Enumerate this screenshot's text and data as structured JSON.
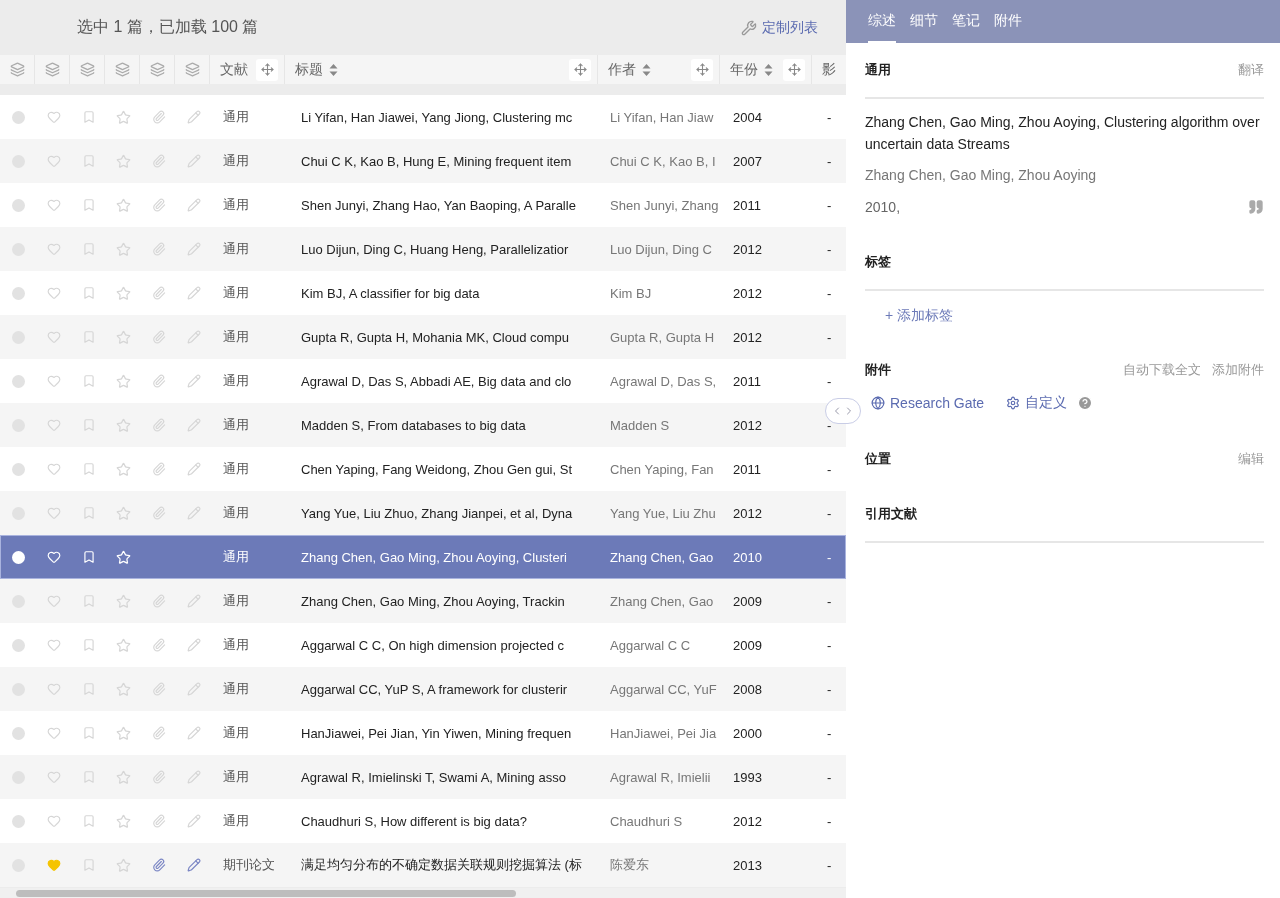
{
  "list_header": {
    "summary": "选中 1 篇，已加载 100 篇",
    "customize": "定制列表"
  },
  "columns": [
    {
      "kind": "icon"
    },
    {
      "kind": "icon"
    },
    {
      "kind": "icon"
    },
    {
      "kind": "icon"
    },
    {
      "kind": "icon"
    },
    {
      "kind": "icon"
    },
    {
      "kind": "text",
      "label": "文献",
      "sortable": false,
      "movable": true
    },
    {
      "kind": "text",
      "label": "标题",
      "sortable": true,
      "movable": true
    },
    {
      "kind": "text",
      "label": "作者",
      "sortable": true,
      "movable": true
    },
    {
      "kind": "text",
      "label": "年份",
      "sortable": true,
      "movable": true
    },
    {
      "kind": "text",
      "label": "影",
      "sortable": false,
      "movable": false
    }
  ],
  "rows": [
    {
      "type": "通用",
      "title": "Li Yifan, Han Jiawei, Yang Jiong, Clustering mc",
      "author": "Li Yifan, Han Jiaw",
      "year": "2004",
      "impact": "-",
      "selected": false,
      "favorite": false,
      "attachment": false,
      "note": false
    },
    {
      "type": "通用",
      "title": "Chui C K, Kao B, Hung E, Mining frequent item",
      "author": "Chui C K, Kao B, I",
      "year": "2007",
      "impact": "-",
      "selected": false,
      "favorite": false,
      "attachment": false,
      "note": false
    },
    {
      "type": "通用",
      "title": "Shen Junyi, Zhang Hao, Yan Baoping, A Paralle",
      "author": "Shen Junyi, Zhang",
      "year": "2011",
      "impact": "-",
      "selected": false,
      "favorite": false,
      "attachment": false,
      "note": false
    },
    {
      "type": "通用",
      "title": "Luo Dijun, Ding C, Huang Heng, Parallelizatior",
      "author": "Luo Dijun, Ding C",
      "year": "2012",
      "impact": "-",
      "selected": false,
      "favorite": false,
      "attachment": false,
      "note": false
    },
    {
      "type": "通用",
      "title": "Kim BJ, A classifier for big data",
      "author": "Kim BJ",
      "year": "2012",
      "impact": "-",
      "selected": false,
      "favorite": false,
      "attachment": false,
      "note": false
    },
    {
      "type": "通用",
      "title": "Gupta R, Gupta H, Mohania MK, Cloud compu",
      "author": "Gupta R, Gupta H",
      "year": "2012",
      "impact": "-",
      "selected": false,
      "favorite": false,
      "attachment": false,
      "note": false
    },
    {
      "type": "通用",
      "title": "Agrawal D, Das S, Abbadi AE, Big data and clo",
      "author": "Agrawal D, Das S,",
      "year": "2011",
      "impact": "-",
      "selected": false,
      "favorite": false,
      "attachment": false,
      "note": false
    },
    {
      "type": "通用",
      "title": "Madden S, From databases to big data",
      "author": "Madden S",
      "year": "2012",
      "impact": "-",
      "selected": false,
      "favorite": false,
      "attachment": false,
      "note": false
    },
    {
      "type": "通用",
      "title": "Chen Yaping, Fang Weidong, Zhou Gen gui, St",
      "author": "Chen Yaping, Fan",
      "year": "2011",
      "impact": "-",
      "selected": false,
      "favorite": false,
      "attachment": false,
      "note": false
    },
    {
      "type": "通用",
      "title": "Yang Yue, Liu Zhuo, Zhang Jianpei, et al, Dyna",
      "author": "Yang Yue, Liu Zhu",
      "year": "2012",
      "impact": "-",
      "selected": false,
      "favorite": false,
      "attachment": false,
      "note": false
    },
    {
      "type": "通用",
      "title": "Zhang Chen, Gao Ming, Zhou Aoying, Clusteri",
      "author": "Zhang Chen, Gao",
      "year": "2010",
      "impact": "-",
      "selected": true,
      "favorite": false,
      "attachment": false,
      "note": false
    },
    {
      "type": "通用",
      "title": "Zhang Chen, Gao Ming, Zhou Aoying, Trackin",
      "author": "Zhang Chen, Gao",
      "year": "2009",
      "impact": "-",
      "selected": false,
      "favorite": false,
      "attachment": false,
      "note": false
    },
    {
      "type": "通用",
      "title": "Aggarwal C C, On high dimension projected c",
      "author": "Aggarwal C C",
      "year": "2009",
      "impact": "-",
      "selected": false,
      "favorite": false,
      "attachment": false,
      "note": false
    },
    {
      "type": "通用",
      "title": "Aggarwal CC, YuP S, A framework for clusterir",
      "author": "Aggarwal CC, YuF",
      "year": "2008",
      "impact": "-",
      "selected": false,
      "favorite": false,
      "attachment": false,
      "note": false
    },
    {
      "type": "通用",
      "title": "HanJiawei, Pei Jian, Yin Yiwen, Mining frequen",
      "author": "HanJiawei, Pei Jia",
      "year": "2000",
      "impact": "-",
      "selected": false,
      "favorite": false,
      "attachment": false,
      "note": false
    },
    {
      "type": "通用",
      "title": "Agrawal R, Imielinski T, Swami A, Mining asso",
      "author": "Agrawal R, Imielii",
      "year": "1993",
      "impact": "-",
      "selected": false,
      "favorite": false,
      "attachment": false,
      "note": false
    },
    {
      "type": "通用",
      "title": "Chaudhuri S, How different is big data?",
      "author": "Chaudhuri S",
      "year": "2012",
      "impact": "-",
      "selected": false,
      "favorite": false,
      "attachment": false,
      "note": false
    },
    {
      "type": "期刊论文",
      "title": "满足均匀分布的不确定数据关联规则挖掘算法 (标",
      "author": "陈爱东",
      "year": "2013",
      "impact": "-",
      "selected": false,
      "favorite": true,
      "attachment": true,
      "note": true
    }
  ],
  "detail_tabs": [
    {
      "label": "综述",
      "selected": true
    },
    {
      "label": "细节",
      "selected": false
    },
    {
      "label": "笔记",
      "selected": false
    },
    {
      "label": "附件",
      "selected": false
    }
  ],
  "general": {
    "heading": "通用",
    "action": "翻译",
    "title": "Zhang Chen, Gao Ming, Zhou Aoying, Clustering algorithm over uncertain data Streams",
    "authors": "Zhang Chen, Gao Ming, Zhou Aoying",
    "year": "2010,"
  },
  "tags": {
    "heading": "标签",
    "add": "+ 添加标签"
  },
  "attachments": {
    "heading": "附件",
    "actions": [
      "自动下载全文",
      "添加附件"
    ],
    "sources": [
      {
        "kind": "globe",
        "label": "Research Gate"
      },
      {
        "kind": "gear",
        "label": "自定义"
      }
    ]
  },
  "location": {
    "heading": "位置",
    "action": "编辑"
  },
  "references": {
    "heading": "引用文献"
  }
}
